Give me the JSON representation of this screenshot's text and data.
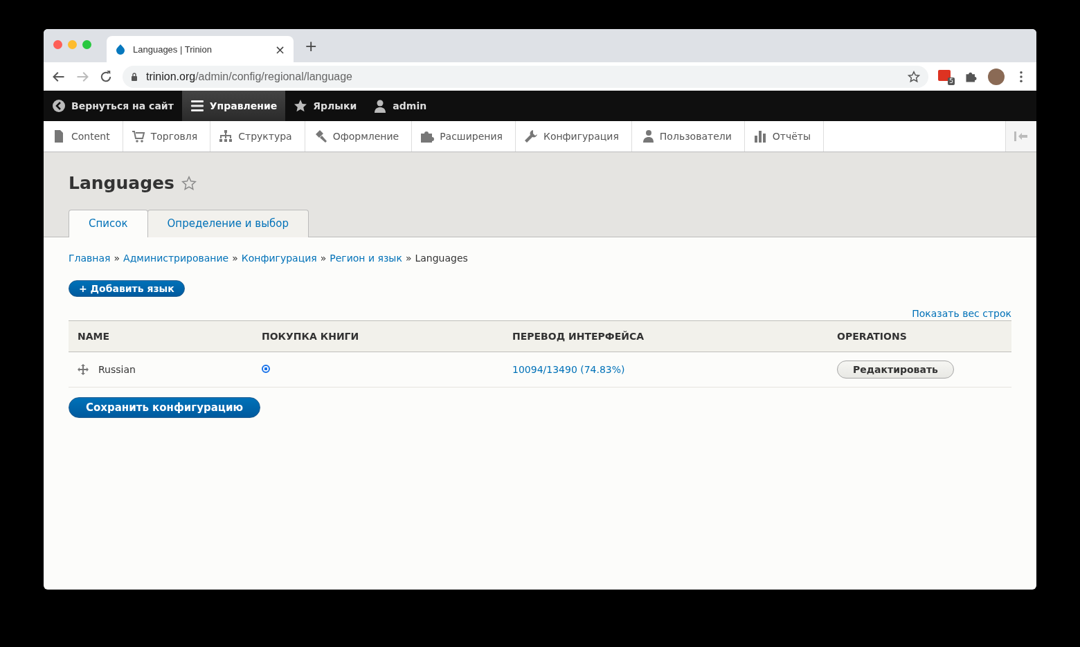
{
  "browser": {
    "tab_title": "Languages | Trinion",
    "tab_close": "×",
    "new_tab": "+",
    "url_host": "trinion.org",
    "url_path": "/admin/config/regional/language",
    "extension_badge": "5"
  },
  "admin_bar": [
    {
      "label": "Вернуться на сайт",
      "selected": false
    },
    {
      "label": "Управление",
      "selected": true
    },
    {
      "label": "Ярлыки",
      "selected": false
    },
    {
      "label": "admin",
      "selected": false
    }
  ],
  "menu": [
    "Content",
    "Торговля",
    "Структура",
    "Оформление",
    "Расширения",
    "Конфигурация",
    "Пользователи",
    "Отчёты"
  ],
  "page": {
    "title": "Languages"
  },
  "tabs": [
    {
      "label": "Список",
      "selected": true
    },
    {
      "label": "Определение и выбор",
      "selected": false
    }
  ],
  "breadcrumbs": [
    {
      "label": "Главная",
      "link": true
    },
    {
      "label": "Администрирование",
      "link": true
    },
    {
      "label": "Конфигурация",
      "link": true
    },
    {
      "label": "Регион и язык",
      "link": true
    },
    {
      "label": "Languages",
      "link": false
    }
  ],
  "breadcrumb_separator": "»",
  "add_button": "+ Добавить язык",
  "show_weights": "Показать вес строк",
  "table": {
    "columns": [
      "NAME",
      "ПОКУПКА КНИГИ",
      "ПЕРЕВОД ИНТЕРФЕЙСА",
      "OPERATIONS"
    ],
    "rows": [
      {
        "name": "Russian",
        "default": true,
        "translation": "10094/13490 (74.83%)",
        "operation": "Редактировать"
      }
    ]
  },
  "save_button": "Сохранить конфигурацию"
}
